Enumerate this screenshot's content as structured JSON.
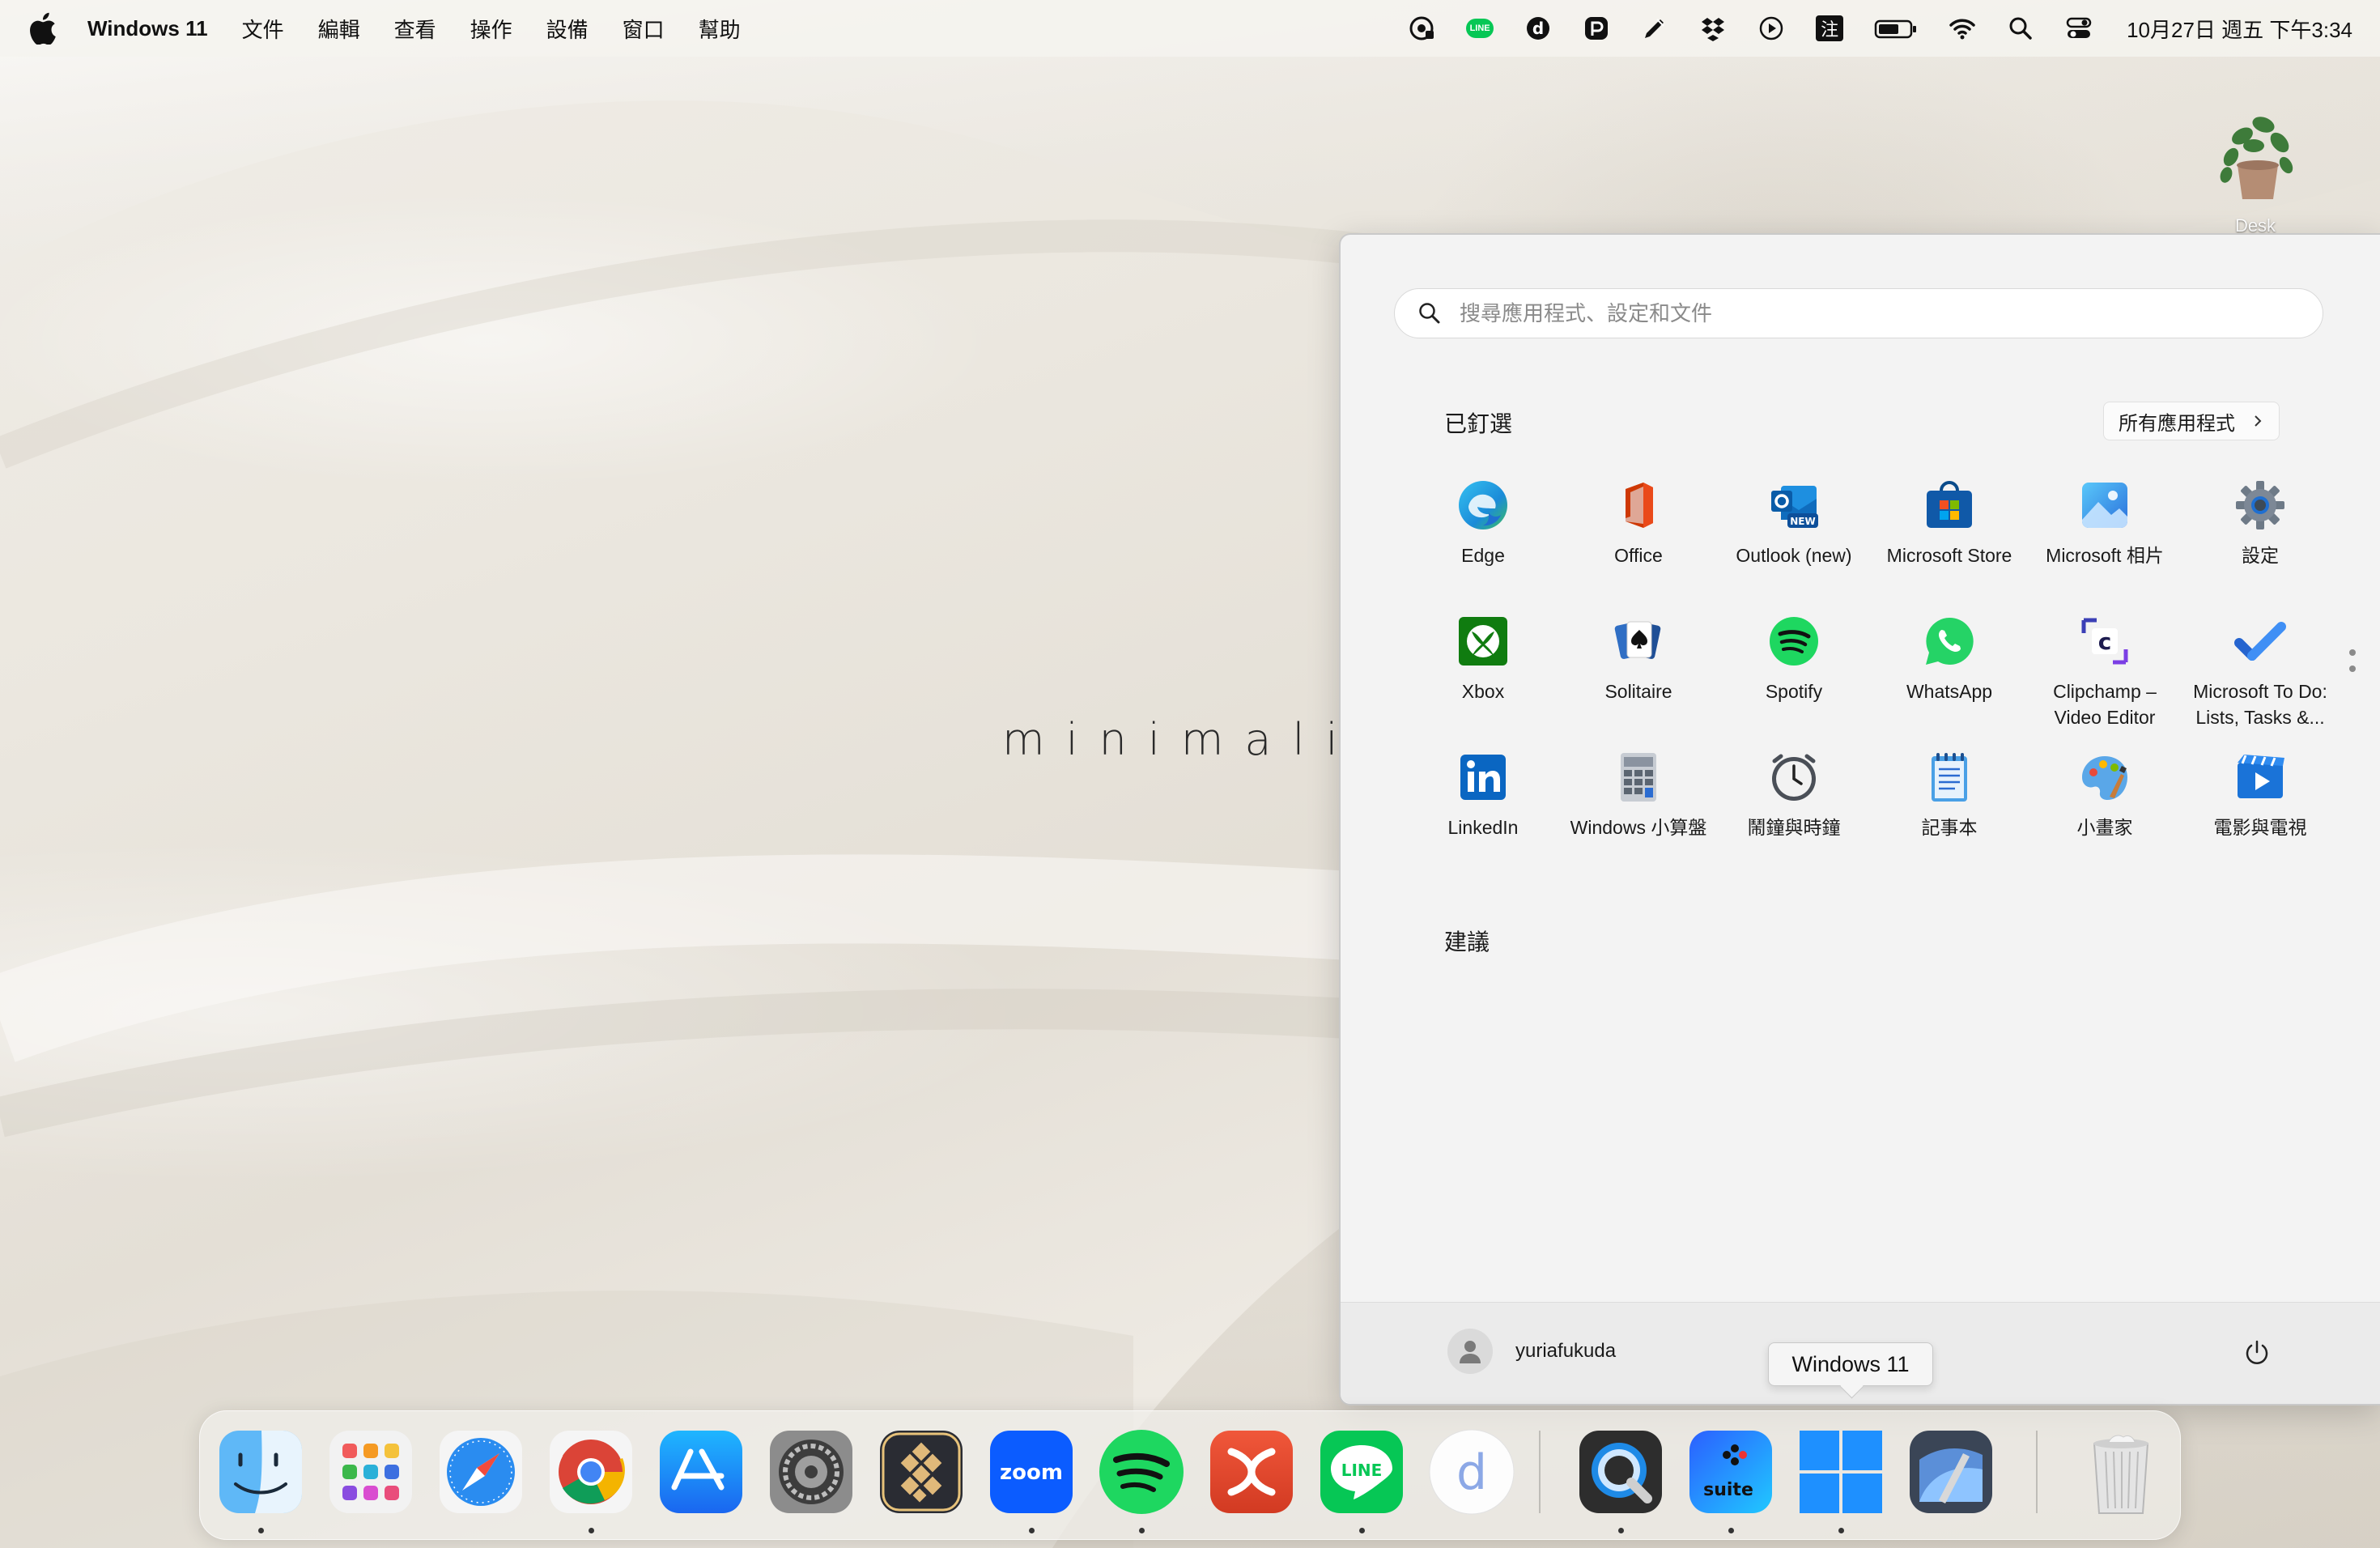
{
  "menubar": {
    "app_name": "Windows 11",
    "menus": [
      "文件",
      "編輯",
      "查看",
      "操作",
      "設備",
      "窗口",
      "幫助"
    ],
    "status_icons": [
      "broadcast-icon",
      "line-icon",
      "d-icon",
      "pocket-icon",
      "pen-icon",
      "dropbox-icon",
      "play-icon",
      "ime-icon",
      "battery-icon",
      "wifi-icon",
      "search-icon",
      "control-center-icon"
    ],
    "ime_label": "注",
    "line_label": "LINE",
    "clock": "10月27日 週五 下午3:34"
  },
  "wallpaper": {
    "text": "minimalis"
  },
  "desktop": {
    "icon_label": "Desk"
  },
  "start_menu": {
    "search_placeholder": "搜尋應用程式、設定和文件",
    "pinned_title": "已釘選",
    "all_apps_label": "所有應用程式",
    "pinned_apps": [
      {
        "label": "Edge",
        "icon": "edge-icon"
      },
      {
        "label": "Office",
        "icon": "office-icon"
      },
      {
        "label": "Outlook (new)",
        "icon": "outlook-icon"
      },
      {
        "label": "Microsoft Store",
        "icon": "store-icon"
      },
      {
        "label": "Microsoft 相片",
        "icon": "photos-icon"
      },
      {
        "label": "設定",
        "icon": "settings-icon"
      },
      {
        "label": "Xbox",
        "icon": "xbox-icon"
      },
      {
        "label": "Solitaire",
        "icon": "solitaire-icon"
      },
      {
        "label": "Spotify",
        "icon": "spotify-icon"
      },
      {
        "label": "WhatsApp",
        "icon": "whatsapp-icon"
      },
      {
        "label": "Clipchamp –\nVideo Editor",
        "icon": "clipchamp-icon"
      },
      {
        "label": "Microsoft To Do:\nLists, Tasks &...",
        "icon": "todo-icon"
      },
      {
        "label": "LinkedIn",
        "icon": "linkedin-icon"
      },
      {
        "label": "Windows 小算盤",
        "icon": "calculator-icon"
      },
      {
        "label": "鬧鐘與時鐘",
        "icon": "clock-icon"
      },
      {
        "label": "記事本",
        "icon": "notepad-icon"
      },
      {
        "label": "小畫家",
        "icon": "paint-icon"
      },
      {
        "label": "電影與電視",
        "icon": "movies-icon"
      }
    ],
    "outlook_badge": "NEW",
    "suggestions_title": "建議",
    "user_name": "yuriafukuda"
  },
  "tooltip": {
    "text": "Windows 11"
  },
  "dock": {
    "items": [
      {
        "name": "finder-icon",
        "running": true
      },
      {
        "name": "launchpad-icon",
        "running": false
      },
      {
        "name": "safari-icon",
        "running": false
      },
      {
        "name": "chrome-icon",
        "running": true
      },
      {
        "name": "app-store-icon",
        "running": false
      },
      {
        "name": "system-settings-icon",
        "running": false
      },
      {
        "name": "klack-icon",
        "running": false
      },
      {
        "name": "zoom-icon",
        "running": true
      },
      {
        "name": "spotify-icon",
        "running": true
      },
      {
        "name": "mindnode-icon",
        "running": false
      },
      {
        "name": "line-icon",
        "running": true
      },
      {
        "name": "dict-icon",
        "running": false
      },
      {
        "name": "quicktime-icon",
        "running": true
      },
      {
        "name": "parallels-suite-icon",
        "running": true
      },
      {
        "name": "windows-11-icon",
        "running": true
      },
      {
        "name": "preview-icon",
        "running": false
      },
      {
        "name": "trash-icon",
        "running": false
      }
    ],
    "zoom_label": "zoom",
    "line_label": "LINE",
    "suite_label": "suite",
    "dict_label": "d"
  },
  "colors": {
    "accent_blue": "#0067c0",
    "line_green": "#06c755",
    "spotify_green": "#1ed760"
  }
}
